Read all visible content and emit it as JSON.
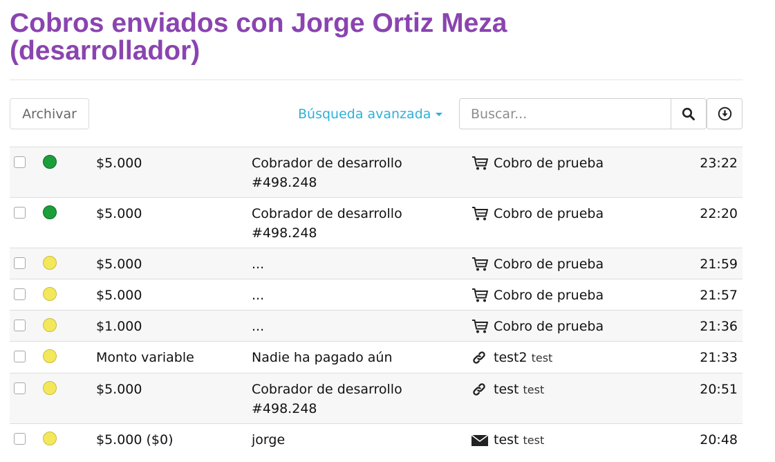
{
  "header": {
    "title_line1": "Cobros enviados con Jorge Ortiz Meza",
    "title_line2": "(desarrollador)"
  },
  "toolbar": {
    "archive_label": "Archivar",
    "advanced_search_label": "Búsqueda avanzada",
    "search_placeholder": "Buscar...",
    "search_icon": "search-icon",
    "download_icon": "download-circle-icon"
  },
  "colors": {
    "title": "#8a44b0",
    "link": "#2fb0d8",
    "status_paid": "#1a9f3a",
    "status_pending": "#f3e85c"
  },
  "rows": [
    {
      "status": "paid",
      "amount": "$5.000",
      "payer_line1": "Cobrador de desarrollo",
      "payer_line2": "#498.248",
      "concept_icon": "cart-icon",
      "concept": "Cobro de prueba",
      "concept_sub": "",
      "time": "23:22"
    },
    {
      "status": "paid",
      "amount": "$5.000",
      "payer_line1": "Cobrador de desarrollo",
      "payer_line2": "#498.248",
      "concept_icon": "cart-icon",
      "concept": "Cobro de prueba",
      "concept_sub": "",
      "time": "22:20"
    },
    {
      "status": "pending",
      "amount": "$5.000",
      "payer_line1": "...",
      "payer_line2": "",
      "concept_icon": "cart-icon",
      "concept": "Cobro de prueba",
      "concept_sub": "",
      "time": "21:59"
    },
    {
      "status": "pending",
      "amount": "$5.000",
      "payer_line1": "...",
      "payer_line2": "",
      "concept_icon": "cart-icon",
      "concept": "Cobro de prueba",
      "concept_sub": "",
      "time": "21:57"
    },
    {
      "status": "pending",
      "amount": "$1.000",
      "payer_line1": "...",
      "payer_line2": "",
      "concept_icon": "cart-icon",
      "concept": "Cobro de prueba",
      "concept_sub": "",
      "time": "21:36"
    },
    {
      "status": "pending",
      "amount": "Monto variable",
      "payer_line1": "Nadie ha pagado aún",
      "payer_line2": "",
      "concept_icon": "link-icon",
      "concept": "test2",
      "concept_sub": "test",
      "time": "21:33"
    },
    {
      "status": "pending",
      "amount": "$5.000",
      "payer_line1": "Cobrador de desarrollo",
      "payer_line2": "#498.248",
      "concept_icon": "link-icon",
      "concept": "test",
      "concept_sub": "test",
      "time": "20:51"
    },
    {
      "status": "pending",
      "amount": "$5.000 ($0)",
      "payer_line1": "jorge",
      "payer_line2": "",
      "concept_icon": "envelope-icon",
      "concept": "test",
      "concept_sub": "test",
      "time": "20:48"
    }
  ]
}
